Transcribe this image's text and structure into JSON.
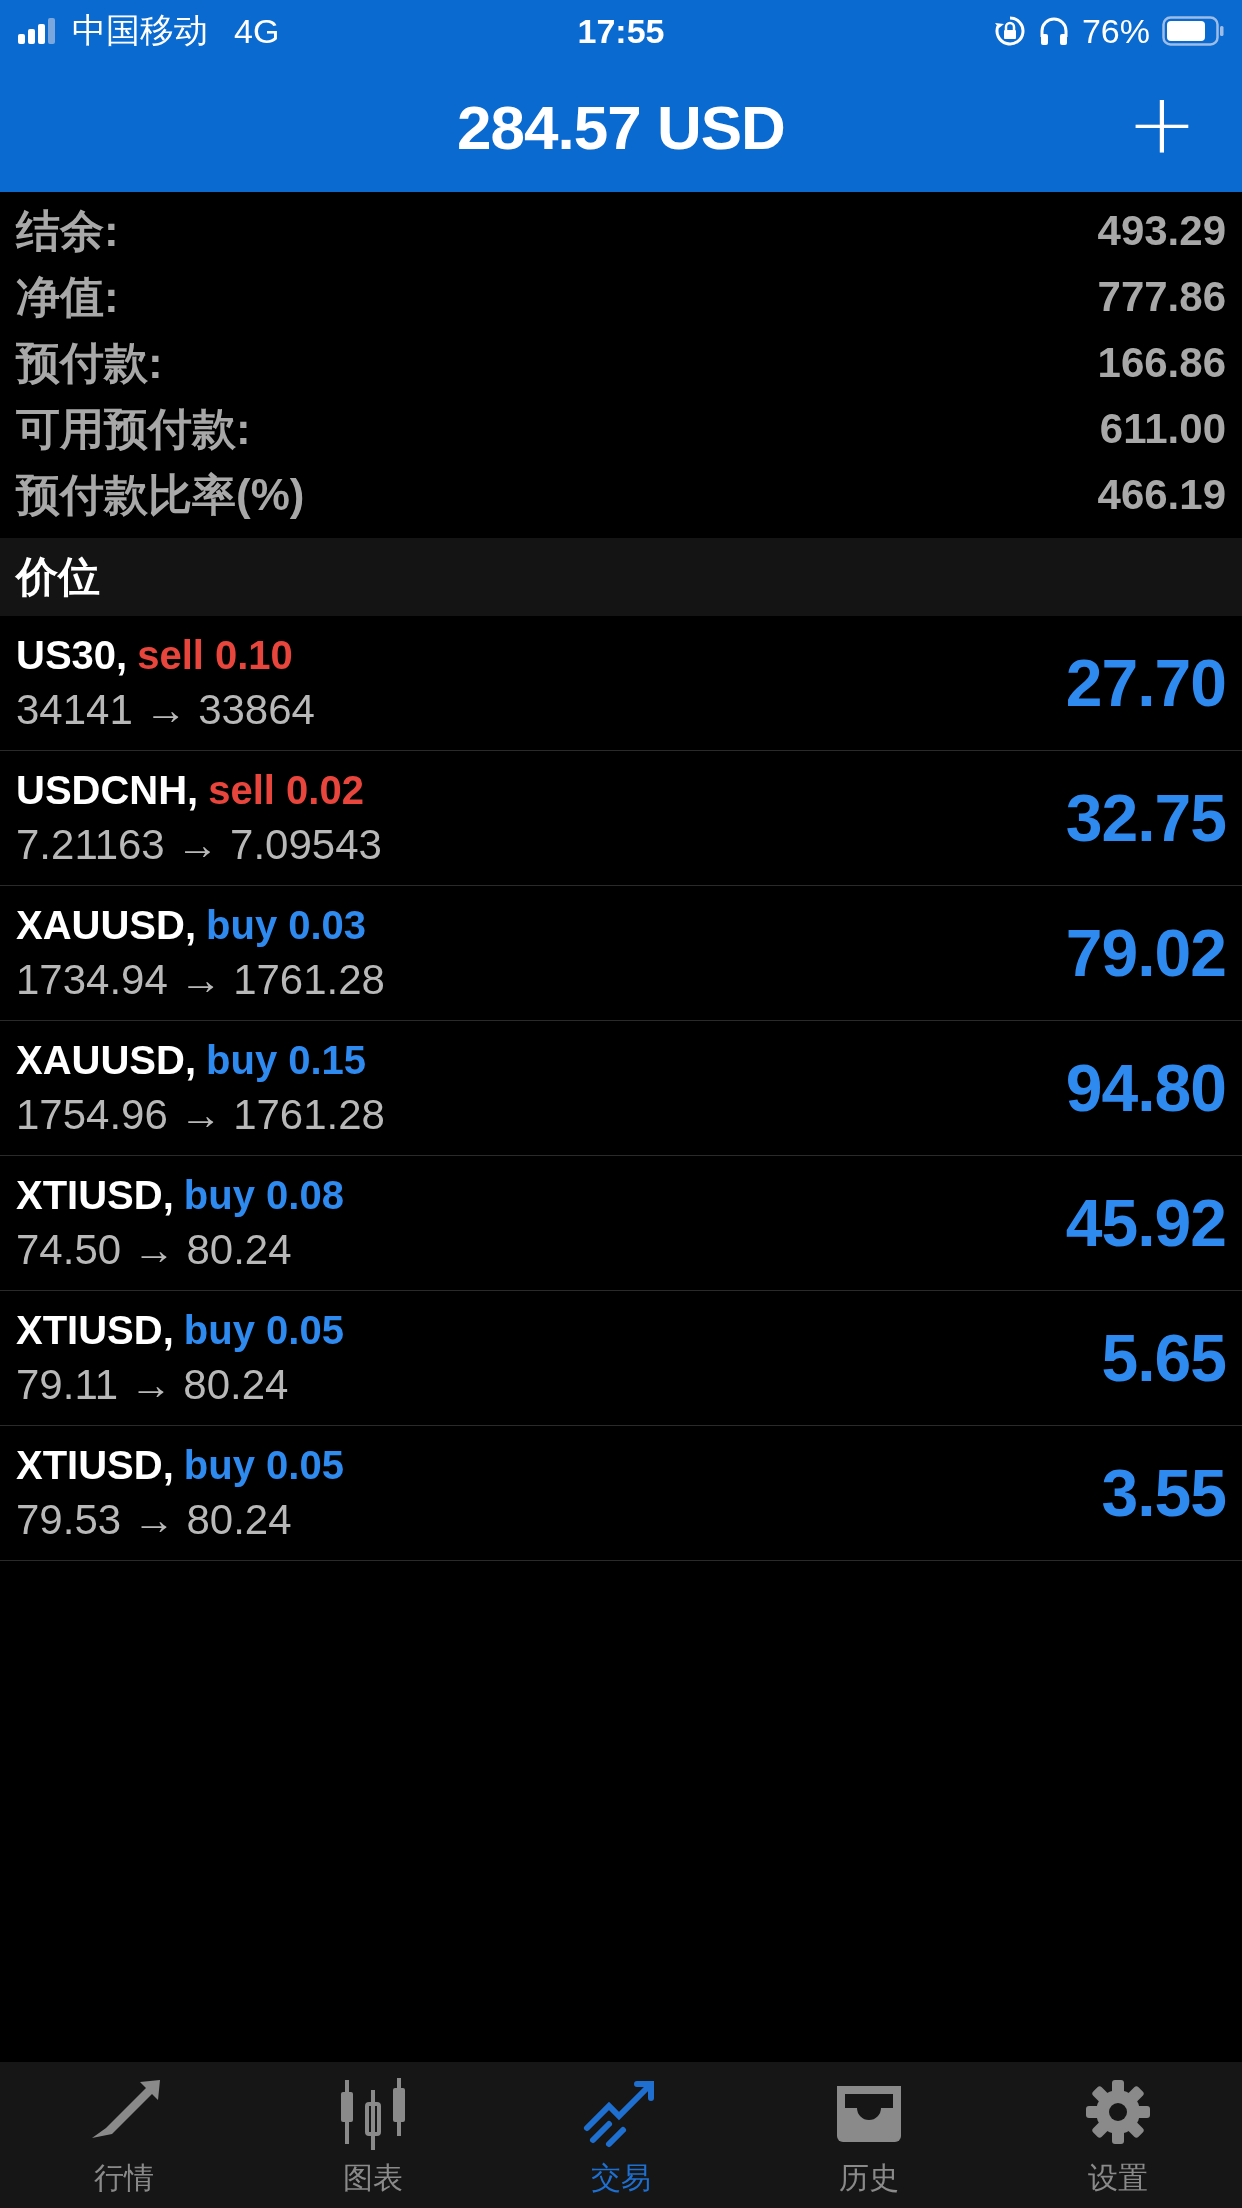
{
  "status_bar": {
    "carrier": "中国移动",
    "network": "4G",
    "time": "17:55",
    "battery": "76%"
  },
  "header": {
    "title": "284.57 USD",
    "add_button": "+"
  },
  "summary": [
    {
      "label": "结余:",
      "value": "493.29"
    },
    {
      "label": "净值:",
      "value": "777.86"
    },
    {
      "label": "预付款:",
      "value": "166.86"
    },
    {
      "label": "可用预付款:",
      "value": "611.00"
    },
    {
      "label": "预付款比率(%)",
      "value": "466.19"
    }
  ],
  "section_title": "价位",
  "positions": [
    {
      "symbol": "US30,",
      "kind": "sell",
      "order": "sell 0.10",
      "prices": "34141 → 33864",
      "profit": "27.70"
    },
    {
      "symbol": "USDCNH,",
      "kind": "sell",
      "order": "sell 0.02",
      "prices": "7.21163 → 7.09543",
      "profit": "32.75"
    },
    {
      "symbol": "XAUUSD,",
      "kind": "buy",
      "order": "buy 0.03",
      "prices": "1734.94 → 1761.28",
      "profit": "79.02"
    },
    {
      "symbol": "XAUUSD,",
      "kind": "buy",
      "order": "buy 0.15",
      "prices": "1754.96 → 1761.28",
      "profit": "94.80"
    },
    {
      "symbol": "XTIUSD,",
      "kind": "buy",
      "order": "buy 0.08",
      "prices": "74.50 → 80.24",
      "profit": "45.92"
    },
    {
      "symbol": "XTIUSD,",
      "kind": "buy",
      "order": "buy 0.05",
      "prices": "79.11 → 80.24",
      "profit": "5.65"
    },
    {
      "symbol": "XTIUSD,",
      "kind": "buy",
      "order": "buy 0.05",
      "prices": "79.53 → 80.24",
      "profit": "3.55"
    }
  ],
  "tab_bar": [
    {
      "kind": "quotes",
      "label": "行情",
      "selected": false
    },
    {
      "kind": "chart",
      "label": "图表",
      "selected": false
    },
    {
      "kind": "trade",
      "label": "交易",
      "selected": true
    },
    {
      "kind": "history",
      "label": "历史",
      "selected": false
    },
    {
      "kind": "settings",
      "label": "设置",
      "selected": false
    }
  ]
}
